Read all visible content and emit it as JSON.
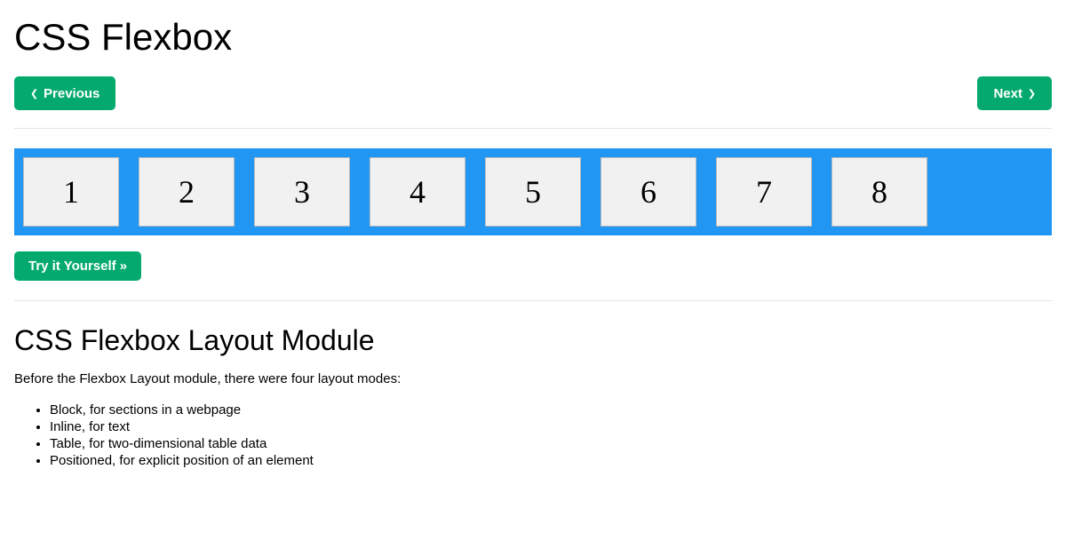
{
  "title": "CSS Flexbox",
  "nav": {
    "prev": "Previous",
    "next": "Next"
  },
  "demo": {
    "items": [
      "1",
      "2",
      "3",
      "4",
      "5",
      "6",
      "7",
      "8"
    ]
  },
  "try_label": "Try it Yourself »",
  "section": {
    "heading": "CSS Flexbox Layout Module",
    "intro": "Before the Flexbox Layout module, there were four layout modes:",
    "modes": [
      "Block, for sections in a webpage",
      "Inline, for text",
      "Table, for two-dimensional table data",
      "Positioned, for explicit position of an element"
    ]
  }
}
